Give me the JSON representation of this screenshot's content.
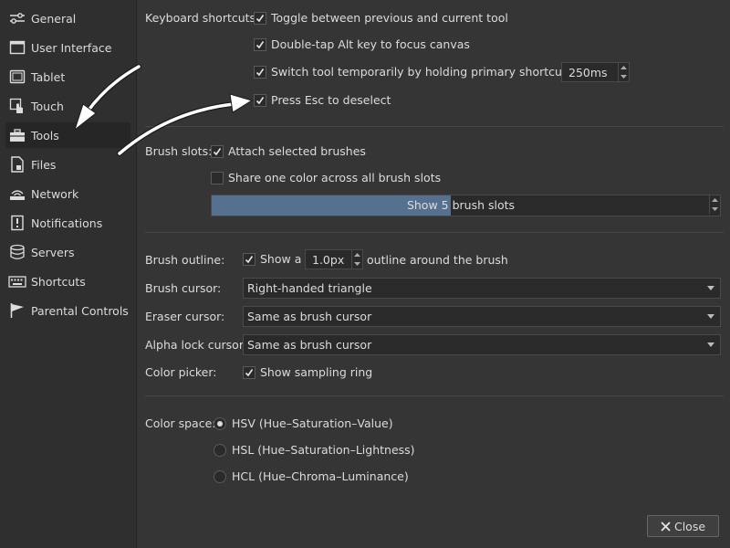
{
  "sidebar": {
    "items": [
      {
        "label": "General",
        "icon": "sliders-icon"
      },
      {
        "label": "User Interface",
        "icon": "window-icon"
      },
      {
        "label": "Tablet",
        "icon": "tablet-icon"
      },
      {
        "label": "Touch",
        "icon": "touch-icon"
      },
      {
        "label": "Tools",
        "icon": "toolbox-icon"
      },
      {
        "label": "Files",
        "icon": "file-icon"
      },
      {
        "label": "Network",
        "icon": "network-icon"
      },
      {
        "label": "Notifications",
        "icon": "notification-icon"
      },
      {
        "label": "Servers",
        "icon": "database-icon"
      },
      {
        "label": "Shortcuts",
        "icon": "keyboard-icon"
      },
      {
        "label": "Parental Controls",
        "icon": "flag-icon"
      }
    ],
    "selected": "Tools"
  },
  "keyboard": {
    "label": "Keyboard shortcuts:",
    "toggle_tool": "Toggle between previous and current tool",
    "double_tap_alt": "Double-tap Alt key to focus canvas",
    "switch_temp": "Switch tool temporarily by holding primary shortcut for",
    "switch_temp_value": "250ms",
    "esc_deselect": "Press Esc to deselect"
  },
  "brush_slots": {
    "label": "Brush slots:",
    "attach": "Attach selected brushes",
    "share_color": "Share one color across all brush slots",
    "slider_text": "Show 5 brush slots",
    "slider_fraction": 0.48
  },
  "outline": {
    "label": "Brush outline:",
    "show_a": "Show a",
    "value": "1.0px",
    "suffix": "outline around the brush"
  },
  "cursors": {
    "brush_label": "Brush cursor:",
    "brush_value": "Right-handed triangle",
    "eraser_label": "Eraser cursor:",
    "eraser_value": "Same as brush cursor",
    "alpha_label": "Alpha lock cursor:",
    "alpha_value": "Same as brush cursor"
  },
  "color_picker": {
    "label": "Color picker:",
    "show_ring": "Show sampling ring"
  },
  "color_space": {
    "label": "Color space:",
    "options": [
      "HSV (Hue–Saturation–Value)",
      "HSL (Hue–Saturation–Lightness)",
      "HCL (Hue–Chroma–Luminance)"
    ],
    "selected": "HSV (Hue–Saturation–Value)"
  },
  "footer": {
    "close": "Close"
  },
  "colors": {
    "accent": "#56708f",
    "background": "#353535",
    "sidebar": "#2f2f2f",
    "arrow": "#ffffff"
  }
}
